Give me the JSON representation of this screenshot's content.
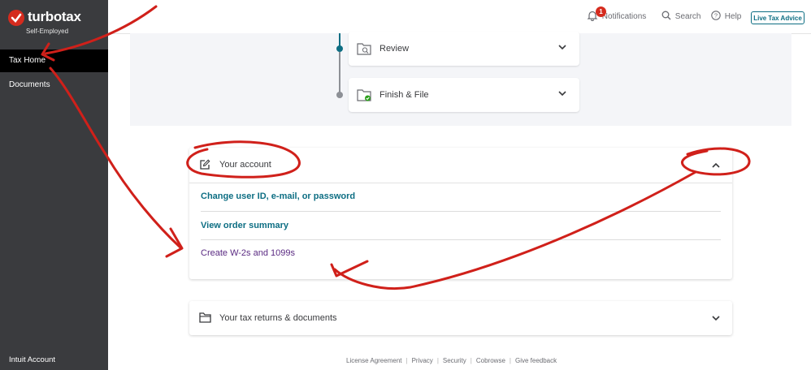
{
  "sidebar": {
    "brand": "turbotax",
    "edition": "Self-Employed",
    "items": [
      {
        "label": "Tax Home",
        "active": true
      },
      {
        "label": "Documents",
        "active": false
      }
    ],
    "footer_label": "Intuit Account"
  },
  "topbar": {
    "notifications_label": "Notifications",
    "notifications_count": "1",
    "search_label": "Search",
    "help_label": "Help",
    "live_advice_label": "Live Tax Advice"
  },
  "steps": [
    {
      "label": "Review",
      "icon": "review-folder-icon"
    },
    {
      "label": "Finish & File",
      "icon": "finish-folder-icon"
    }
  ],
  "account_card": {
    "title": "Your account",
    "links": [
      "Change user ID, e-mail, or password",
      "View order summary",
      "Create W-2s and 1099s"
    ]
  },
  "returns_card": {
    "title": "Your tax returns & documents"
  },
  "footer": {
    "links": [
      "License Agreement",
      "Privacy",
      "Security",
      "Cobrowse",
      "Give feedback"
    ]
  },
  "colors": {
    "sidebar": "#3a3b3e",
    "accent_teal": "#0d6e83",
    "link_purple": "#5a2a82",
    "brand_red": "#d52b1e",
    "annotation_red": "#d0201a"
  }
}
